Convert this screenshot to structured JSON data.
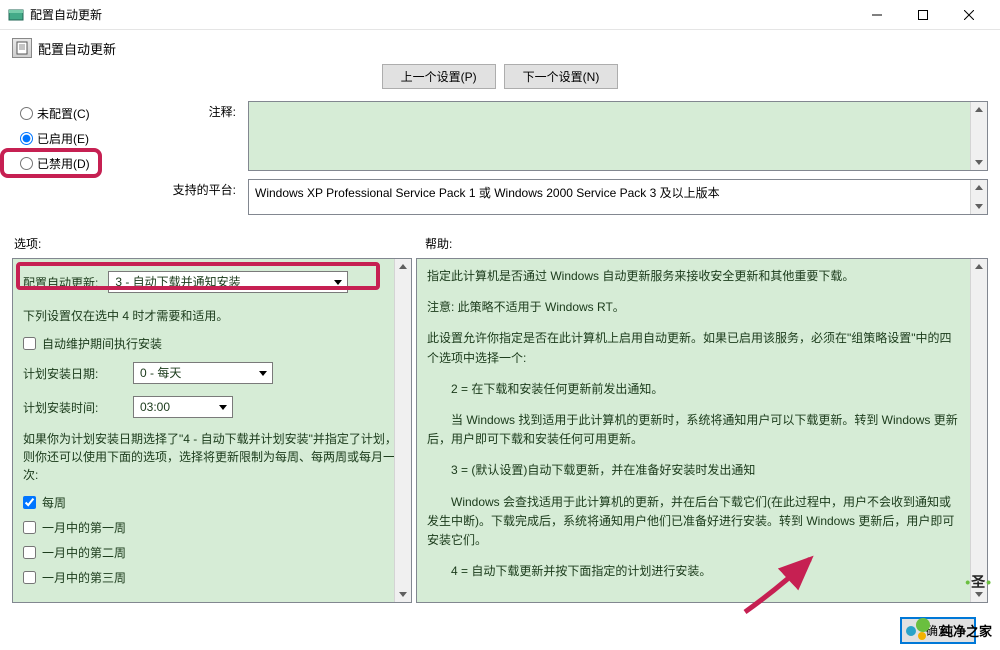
{
  "titlebar": {
    "title": "配置自动更新"
  },
  "subtitle": "配置自动更新",
  "nav": {
    "prev": "上一个设置(P)",
    "next": "下一个设置(N)"
  },
  "radios": {
    "not_configured": "未配置(C)",
    "enabled": "已启用(E)",
    "disabled": "已禁用(D)"
  },
  "labels": {
    "comment": "注释:",
    "platform": "支持的平台:",
    "options": "选项:",
    "help": "帮助:"
  },
  "platform_text": "Windows XP Professional Service Pack 1 或 Windows 2000 Service Pack 3 及以上版本",
  "options": {
    "configLabel": "配置自动更新:",
    "configValue": "3 - 自动下载并通知安装",
    "note": "下列设置仅在选中 4 时才需要和适用。",
    "maintCheckbox": "自动维护期间执行安装",
    "schedDayLabel": "计划安装日期:",
    "schedDayValue": "0 - 每天",
    "schedTimeLabel": "计划安装时间:",
    "schedTimeValue": "03:00",
    "longNote": "如果你为计划安装日期选择了\"4 - 自动下载并计划安装\"并指定了计划，则你还可以使用下面的选项，选择将更新限制为每周、每两周或每月一次:",
    "weekly": "每周",
    "week1": "一月中的第一周",
    "week2": "一月中的第二周",
    "week3": "一月中的第三周"
  },
  "help": {
    "p1": "指定此计算机是否通过 Windows 自动更新服务来接收安全更新和其他重要下载。",
    "p2": "注意: 此策略不适用于 Windows RT。",
    "p3": "此设置允许你指定是否在此计算机上启用自动更新。如果已启用该服务，必须在\"组策略设置\"中的四个选项中选择一个:",
    "p4": "2 = 在下载和安装任何更新前发出通知。",
    "p5": "当 Windows 找到适用于此计算机的更新时，系统将通知用户可以下载更新。转到 Windows 更新后，用户即可下载和安装任何可用更新。",
    "p6": "3 = (默认设置)自动下载更新，并在准备好安装时发出通知",
    "p7": "Windows 会查找适用于此计算机的更新，并在后台下载它们(在此过程中，用户不会收到通知或发生中断)。下载完成后，系统将通知用户他们已准备好进行安装。转到 Windows 更新后，用户即可安装它们。",
    "p8": "4 = 自动下载更新并按下面指定的计划进行安装。"
  },
  "buttons": {
    "ok": "确定"
  },
  "watermark": {
    "brand": "纯净之家",
    "top1": "圣",
    "top2": "•"
  }
}
